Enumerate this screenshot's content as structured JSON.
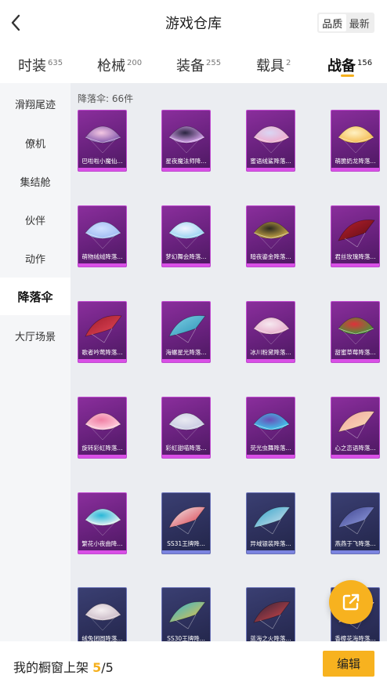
{
  "header": {
    "title": "游戏仓库",
    "sort_options": [
      "品质",
      "最新"
    ],
    "sort_selected": "品质"
  },
  "tabs": [
    {
      "label": "时装",
      "count": "635"
    },
    {
      "label": "枪械",
      "count": "200"
    },
    {
      "label": "装备",
      "count": "255"
    },
    {
      "label": "载具",
      "count": "2"
    },
    {
      "label": "战备",
      "count": "156"
    }
  ],
  "sidebar": {
    "items": [
      "滑翔尾迹",
      "僚机",
      "集结舱",
      "伙伴",
      "动作",
      "降落伞",
      "大厅场景"
    ],
    "selected": "降落伞"
  },
  "content": {
    "count_label": "降落伞: 66件",
    "items": [
      {
        "name": "巴啦啦小魔仙...",
        "rarity": "purple",
        "colors": [
          "#f4c7e2",
          "#7a4fa8"
        ]
      },
      {
        "name": "星夜魔法师降...",
        "rarity": "purple",
        "colors": [
          "#2a2440",
          "#e8b0ff"
        ]
      },
      {
        "name": "蜜语绒鲨降落...",
        "rarity": "purple",
        "colors": [
          "#d9d6f4",
          "#f2a6c8"
        ]
      },
      {
        "name": "萌脆奶龙降落...",
        "rarity": "purple",
        "colors": [
          "#fff1c2",
          "#f3b84a"
        ]
      },
      {
        "name": "萌物绒绒降落...",
        "rarity": "purple",
        "colors": [
          "#cfe0ff",
          "#9cb8f2"
        ]
      },
      {
        "name": "梦幻舞会降落...",
        "rarity": "purple",
        "colors": [
          "#f2f4ff",
          "#8fd0f0"
        ]
      },
      {
        "name": "暗夜鎏金降落...",
        "rarity": "purple",
        "colors": [
          "#2b2a1e",
          "#d6b34c"
        ]
      },
      {
        "name": "君丝玫瑰降落...",
        "rarity": "purple",
        "colors": [
          "#b8202e",
          "#5c0c14"
        ]
      },
      {
        "name": "歌者吟莺降落...",
        "rarity": "purple",
        "colors": [
          "#9c1a2a",
          "#e84a5a"
        ]
      },
      {
        "name": "海螺星光降落...",
        "rarity": "purple",
        "colors": [
          "#7fd2e6",
          "#2a8fb4"
        ]
      },
      {
        "name": "冰川粉黛降落...",
        "rarity": "purple",
        "colors": [
          "#f6e9f0",
          "#e6a9c8"
        ]
      },
      {
        "name": "甜蜜草莓降落...",
        "rarity": "purple",
        "colors": [
          "#e0303a",
          "#3d9c3a"
        ]
      },
      {
        "name": "旋转彩虹降落...",
        "rarity": "purple",
        "colors": [
          "#f07fa4",
          "#ffd4e2"
        ]
      },
      {
        "name": "彩虹甜喵降落...",
        "rarity": "purple",
        "colors": [
          "#e9eaf2",
          "#c6c8e0"
        ]
      },
      {
        "name": "荧光虫舞降落...",
        "rarity": "purple",
        "colors": [
          "#6a4fb8",
          "#3ad0f0"
        ]
      },
      {
        "name": "心之恋语降落...",
        "rarity": "purple",
        "colors": [
          "#f0a6a0",
          "#fbe0b8"
        ]
      },
      {
        "name": "繁花小夜曲降...",
        "rarity": "purple",
        "colors": [
          "#28b8d8",
          "#f4f4f4"
        ]
      },
      {
        "name": "SS31王牌降...",
        "rarity": "blue",
        "colors": [
          "#f2f2f2",
          "#d83040"
        ]
      },
      {
        "name": "异域银装降落...",
        "rarity": "blue",
        "colors": [
          "#2aa0c8",
          "#e0e8f0"
        ]
      },
      {
        "name": "燕燕于飞降落...",
        "rarity": "blue",
        "colors": [
          "#3a3f8a",
          "#9aa6e8"
        ]
      },
      {
        "name": "绒兔团圆降落...",
        "rarity": "blue",
        "colors": [
          "#f4eef0",
          "#c8b8c4"
        ]
      },
      {
        "name": "SS30王牌降...",
        "rarity": "blue",
        "colors": [
          "#2ab4d8",
          "#f6c23a"
        ]
      },
      {
        "name": "蓝海之火降落...",
        "rarity": "blue",
        "colors": [
          "#2a2038",
          "#e04a4a"
        ]
      },
      {
        "name": "香樟花海降落...",
        "rarity": "blue",
        "colors": [
          "#f4f0f4",
          "#d8a0c8"
        ]
      }
    ]
  },
  "footer": {
    "label": "我的橱窗上架",
    "current": "5",
    "total": "/5",
    "edit_label": "编辑"
  },
  "icons": {
    "back": "chevron-left-icon",
    "share": "share-external-icon"
  },
  "colors": {
    "accent": "#f7b21f",
    "rarity_purple": "#c04ad0",
    "rarity_blue": "#6a72b8"
  }
}
